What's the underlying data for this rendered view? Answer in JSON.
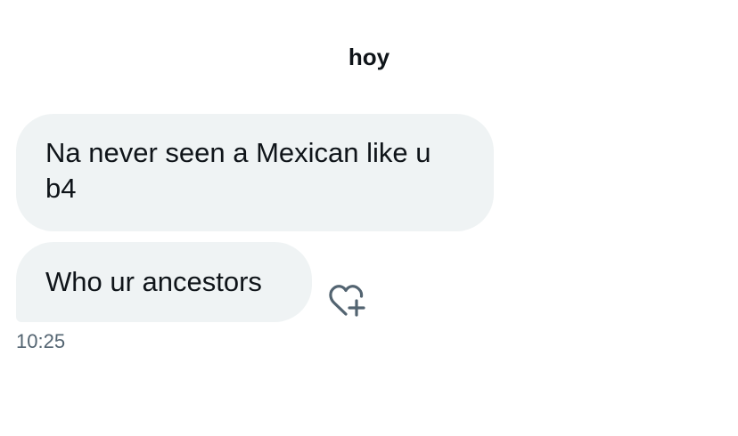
{
  "conversation": {
    "date_header": "hoy",
    "messages": [
      {
        "text": "Na never seen a Mexican like u b4"
      },
      {
        "text": "Who ur ancestors"
      }
    ],
    "timestamp": "10:25",
    "react_icon": "heart-plus-icon"
  },
  "colors": {
    "bubble_bg": "#eff3f4",
    "text": "#0f1419",
    "muted": "#536471",
    "icon": "#536471"
  }
}
